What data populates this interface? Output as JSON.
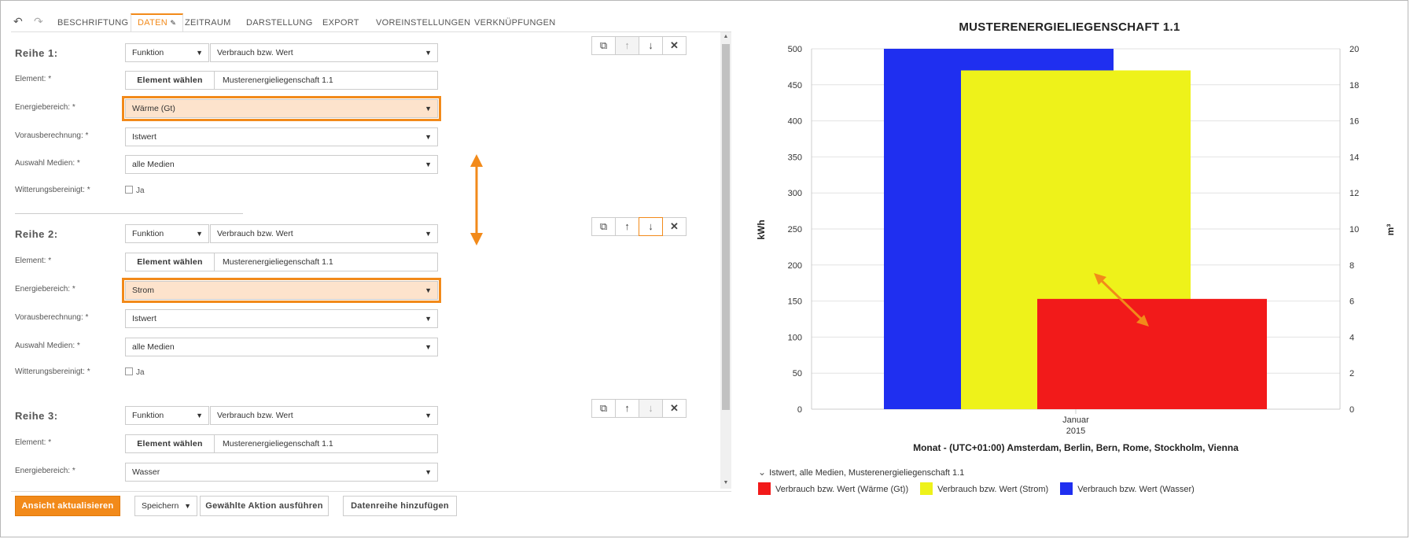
{
  "tabs": [
    "BESCHRIFTUNG",
    "DATEN",
    "ZEITRAUM",
    "DARSTELLUNG",
    "EXPORT",
    "VOREINSTELLUNGEN",
    "VERKNÜPFUNGEN"
  ],
  "active_tab_edit_icon": "✎",
  "labels": {
    "element": "Element: *",
    "energiebereich": "Energiebereich: *",
    "vorausberechnung": "Vorausberechnung: *",
    "auswahl_medien": "Auswahl Medien: *",
    "witterung": "Witterungsbereinigt: *",
    "checkbox_ja": "Ja",
    "element_button": "Element wählen"
  },
  "rows": [
    {
      "title": "Reihe 1:",
      "function": "Funktion",
      "value": "Verbrauch bzw. Wert",
      "element": "Musterenergieliegenschaft 1.1",
      "energiebereich": "Wärme (Gt)",
      "vorausberechnung": "Istwert",
      "medien": "alle Medien"
    },
    {
      "title": "Reihe 2:",
      "function": "Funktion",
      "value": "Verbrauch bzw. Wert",
      "element": "Musterenergieliegenschaft 1.1",
      "energiebereich": "Strom",
      "vorausberechnung": "Istwert",
      "medien": "alle Medien"
    },
    {
      "title": "Reihe 3:",
      "function": "Funktion",
      "value": "Verbrauch bzw. Wert",
      "element": "Musterenergieliegenschaft 1.1",
      "energiebereich": "Wasser"
    }
  ],
  "bottom": {
    "update": "Ansicht aktualisieren",
    "save_select": "Speichern",
    "run_action": "Gewählte Aktion ausführen",
    "add_series": "Datenreihe hinzufügen"
  },
  "colors": {
    "accent": "#f28a1a",
    "blue": "#1f2ff0",
    "yellow": "#eef21a",
    "red": "#f21a1a"
  },
  "chart_data": {
    "type": "bar",
    "title": "MUSTERENERGIELIEGENSCHAFT 1.1",
    "categories": [
      "Januar\n2015"
    ],
    "category_line1": "Januar",
    "category_line2": "2015",
    "xlabel": "Monat - (UTC+01:00) Amsterdam, Berlin, Bern, Rome, Stockholm, Vienna",
    "ylabel": "kWh",
    "y2label": "m³",
    "ylim": [
      0,
      500
    ],
    "y2lim": [
      0,
      20
    ],
    "yticks": [
      0,
      50,
      100,
      150,
      200,
      250,
      300,
      350,
      400,
      450,
      500
    ],
    "y2ticks": [
      0,
      2,
      4,
      6,
      8,
      10,
      12,
      14,
      16,
      18,
      20
    ],
    "grid": true,
    "series": [
      {
        "name": "Verbrauch bzw. Wert (Wasser)",
        "axis": "y2",
        "values": [
          20
        ],
        "color": "#1f2ff0"
      },
      {
        "name": "Verbrauch bzw. Wert (Strom)",
        "axis": "y",
        "values": [
          470
        ],
        "color": "#eef21a"
      },
      {
        "name": "Verbrauch bzw. Wert (Wärme (Gt))",
        "axis": "y",
        "values": [
          153
        ],
        "color": "#f21a1a"
      }
    ],
    "legend_group": "Istwert, alle Medien, Musterenergieliegenschaft 1.1",
    "legend_order": [
      "Verbrauch bzw. Wert (Wärme (Gt))",
      "Verbrauch bzw. Wert (Strom)",
      "Verbrauch bzw. Wert (Wasser)"
    ]
  }
}
